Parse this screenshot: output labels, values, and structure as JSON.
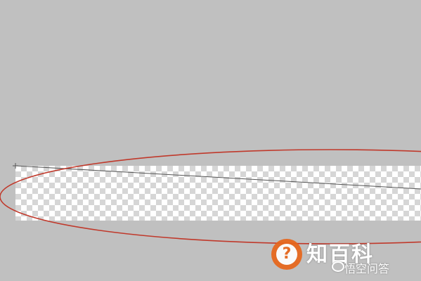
{
  "canvas": {
    "background_color": "#c0c0c0",
    "content": "transparent-checkerboard-selection-strip"
  },
  "annotation": {
    "ellipse_color": "#c0392b",
    "guide_line_color": "#555555"
  },
  "watermark": {
    "icon": "question-mark-icon",
    "question_glyph": "?",
    "brand": "知百科",
    "sub_icon": "chat-bubble-icon",
    "sub_text": "悟空问答",
    "accent_color": "#e8651a"
  }
}
